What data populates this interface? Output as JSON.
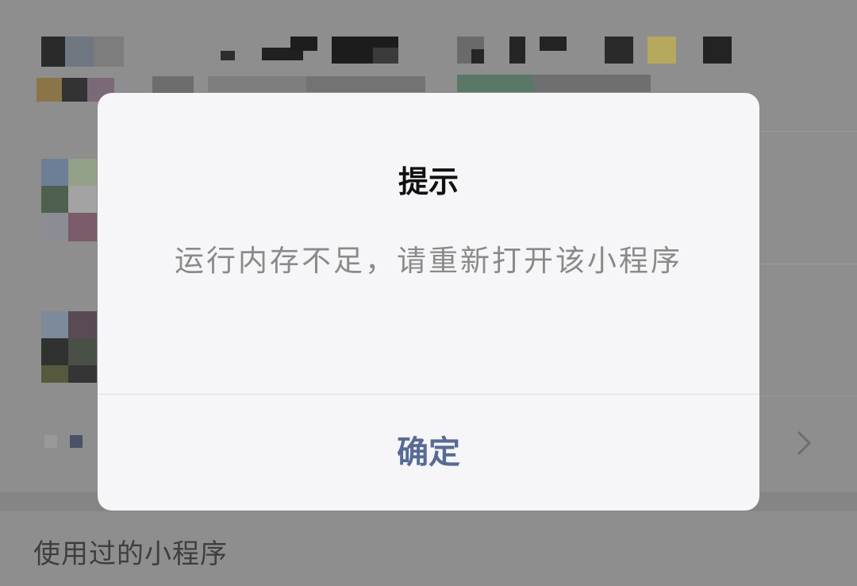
{
  "dialog": {
    "title": "提示",
    "message": "运行内存不足，请重新打开该小程序",
    "confirm_label": "确定"
  },
  "section": {
    "label": "使用过的小程序"
  },
  "colors": {
    "overlay_background": "#8c8c8c",
    "dialog_background": "#f6f6f8",
    "title_text": "#111111",
    "message_text": "#8a8a8a",
    "confirm_text": "#576b95"
  },
  "icons": {
    "row_chevron": "chevron-right-icon"
  }
}
